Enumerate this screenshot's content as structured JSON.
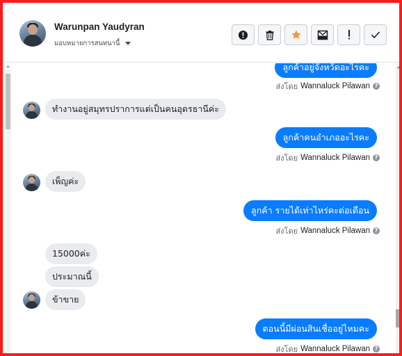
{
  "header": {
    "contact_name": "Warunpan Yaudyran",
    "assign_label": "มอบหมายการสนทนานี้",
    "actions": [
      {
        "icon": "alert-circle-icon"
      },
      {
        "icon": "trash-icon"
      },
      {
        "icon": "star-icon",
        "color": "#f7923b"
      },
      {
        "icon": "mail-archive-icon"
      },
      {
        "icon": "exclamation-icon"
      },
      {
        "icon": "checkmark-icon"
      }
    ]
  },
  "conversation": {
    "sent_by_prefix": "ส่งโดย",
    "agent_name": "Wannaluck Pilawan",
    "help_glyph": "?",
    "messages": [
      {
        "direction": "outgoing",
        "text": "ลูกค้าอยู่จังหวัดอะไรคะ"
      },
      {
        "direction": "incoming",
        "text": "ทำงานอยู่สมุทรปราการแต่เป็นคนอุดรธานีค่ะ"
      },
      {
        "direction": "outgoing",
        "text": "ลูกค้าคนอำเภออะไรคะ"
      },
      {
        "direction": "incoming",
        "text": "เพ็ญค่ะ"
      },
      {
        "direction": "outgoing",
        "text": "ลูกค้า รายได้เท่าไหร่คะต่อเดือน"
      },
      {
        "direction": "incoming",
        "text": "15000ค่ะ"
      },
      {
        "direction": "incoming",
        "text": "ประมาณนี้"
      },
      {
        "direction": "incoming",
        "text": "ข้าขาย"
      },
      {
        "direction": "outgoing",
        "text": "ตอนนี้มีผ่อนสินเชื่ออยู่ไหมคะ"
      }
    ]
  },
  "colors": {
    "outgoing_bubble": "#0a7cff",
    "incoming_bubble": "#e9ebee",
    "frame_border": "#ff1a1a"
  }
}
